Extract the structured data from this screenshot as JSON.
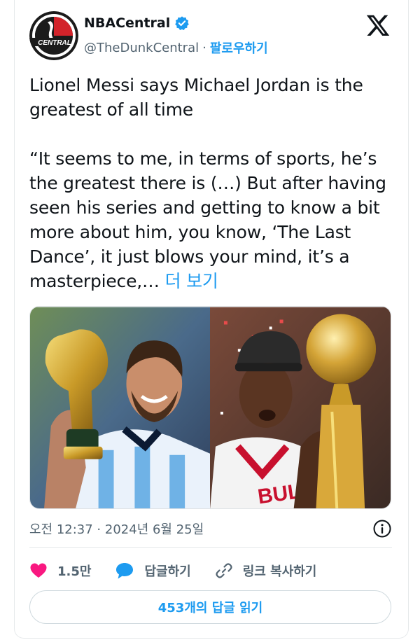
{
  "author": {
    "display_name": "NBACentral",
    "handle": "@TheDunkCentral",
    "separator": "·",
    "follow_label": "팔로우하기",
    "avatar_text": "CENTRAL"
  },
  "tweet": {
    "headline": "Lionel Messi says Michael Jordan is the greatest of all time",
    "quote": "“It seems to me, in terms of sports, he’s the greatest there is (…) But after having seen his series and getting to know a bit more about him, you know, ‘The Last Dance’, it just blows your mind, it’s a masterpiece,…",
    "more_label": "더 보기"
  },
  "meta": {
    "timestamp": "오전 12:37 · 2024년 6월 25일"
  },
  "actions": {
    "likes": "1.5만",
    "reply_label": "답글하기",
    "copy_link_label": "링크 복사하기"
  },
  "replies_button": "453개의 답글 읽기",
  "colors": {
    "accent": "#1d9bf0",
    "like": "#f91880",
    "text": "#0f1419",
    "muted": "#536471"
  }
}
